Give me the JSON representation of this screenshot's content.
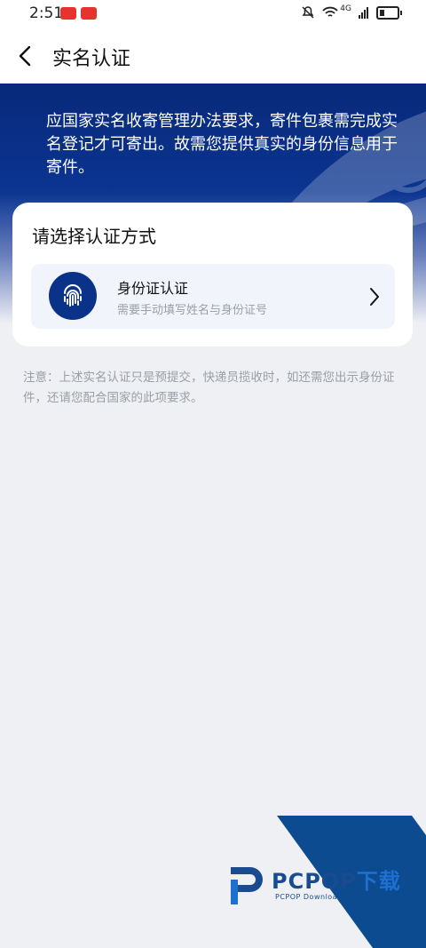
{
  "status_bar": {
    "time": "2:51",
    "network_label": "4G"
  },
  "nav": {
    "title": "实名认证"
  },
  "banner": {
    "text": "应国家实名收寄管理办法要求，寄件包裹需完成实名登记才可寄出。故需您提供真实的身份信息用于寄件。"
  },
  "card": {
    "title": "请选择认证方式",
    "option": {
      "title": "身份证认证",
      "subtitle": "需要手动填写姓名与身份证号",
      "icon": "fingerprint-icon"
    }
  },
  "notice": {
    "text": "注意：上述实名认证只是预提交，快递员揽收时，如还需您出示身份证件，还请您配合国家的此项要求。"
  },
  "watermark": {
    "brand": "PCPOP",
    "brand_suffix": "下载",
    "sub": "PCPOP Download"
  },
  "colors": {
    "primary": "#0a3289",
    "background": "#eff0f4",
    "muted": "#9a9ea6"
  }
}
